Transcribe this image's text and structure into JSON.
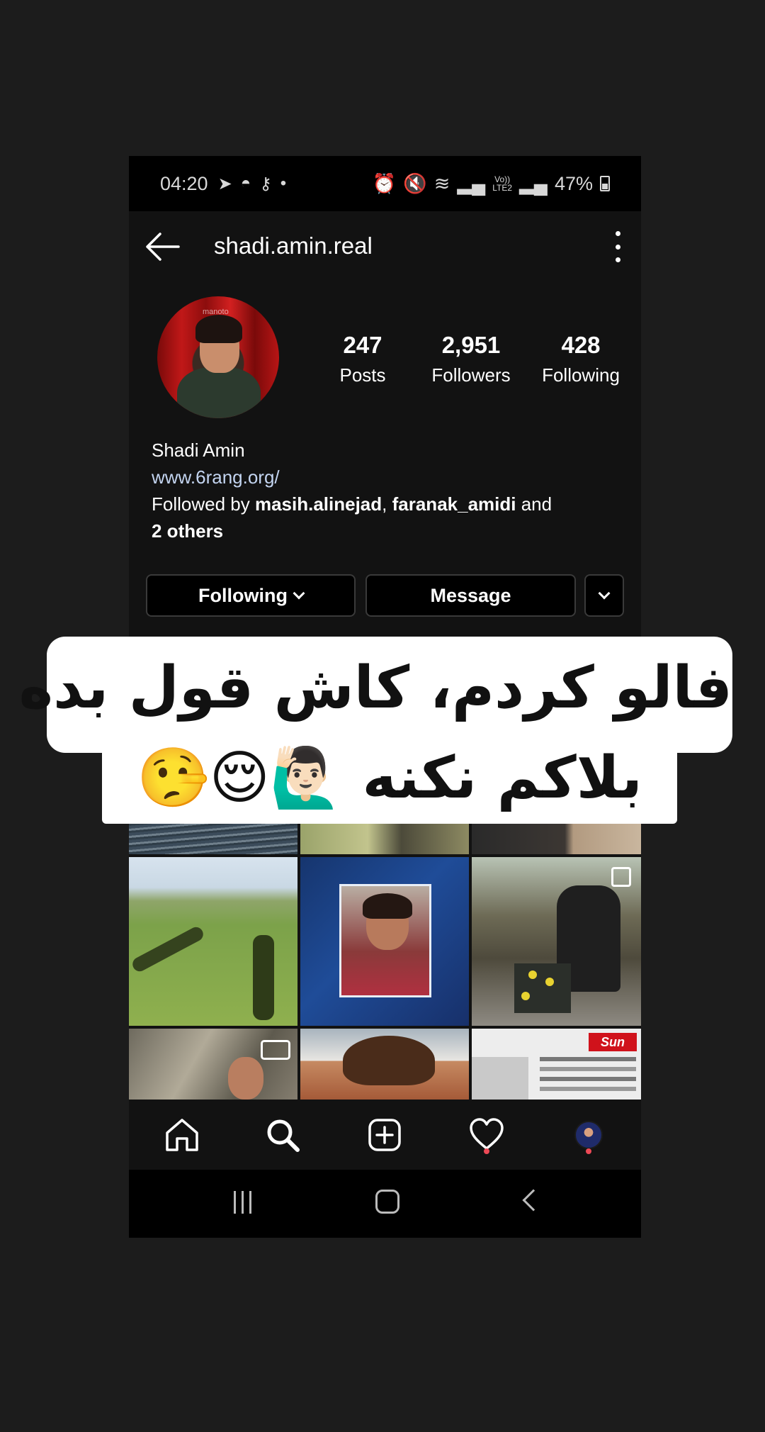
{
  "status_bar": {
    "time": "04:20",
    "volte": "Vo))",
    "lte": "LTE2",
    "battery": "47%"
  },
  "header": {
    "username": "shadi.amin.real"
  },
  "profile": {
    "avatar_watermark": "manoto",
    "posts_count": "247",
    "posts_label": "Posts",
    "followers_count": "2,951",
    "followers_label": "Followers",
    "following_count": "428",
    "following_label": "Following",
    "name": "Shadi Amin",
    "website": "www.6rang.org/",
    "followed_by_prefix": "Followed by ",
    "followed_by_1": "masih.alinejad",
    "followed_by_sep": ", ",
    "followed_by_2": "faranak_amidi",
    "followed_by_and": " and",
    "followed_by_others": "2 others"
  },
  "actions": {
    "following_label": "Following",
    "message_label": "Message"
  },
  "grid_texts": {
    "sun_logo": "Sun"
  },
  "caption": {
    "line1": "فالو کردم، کاش قول بده",
    "line2": "بلاکم نکنه 🙋🏻‍♂️😌🤥"
  },
  "icons": {
    "back": "arrow-left-icon",
    "more": "kebab-menu-icon",
    "home": "home-icon",
    "search": "search-icon",
    "add": "add-post-icon",
    "activity": "heart-icon",
    "profile": "profile-avatar-icon"
  },
  "colors": {
    "notification_dot": "#ed4956",
    "link": "#c3d4f0",
    "sun_red": "#d0121b"
  }
}
